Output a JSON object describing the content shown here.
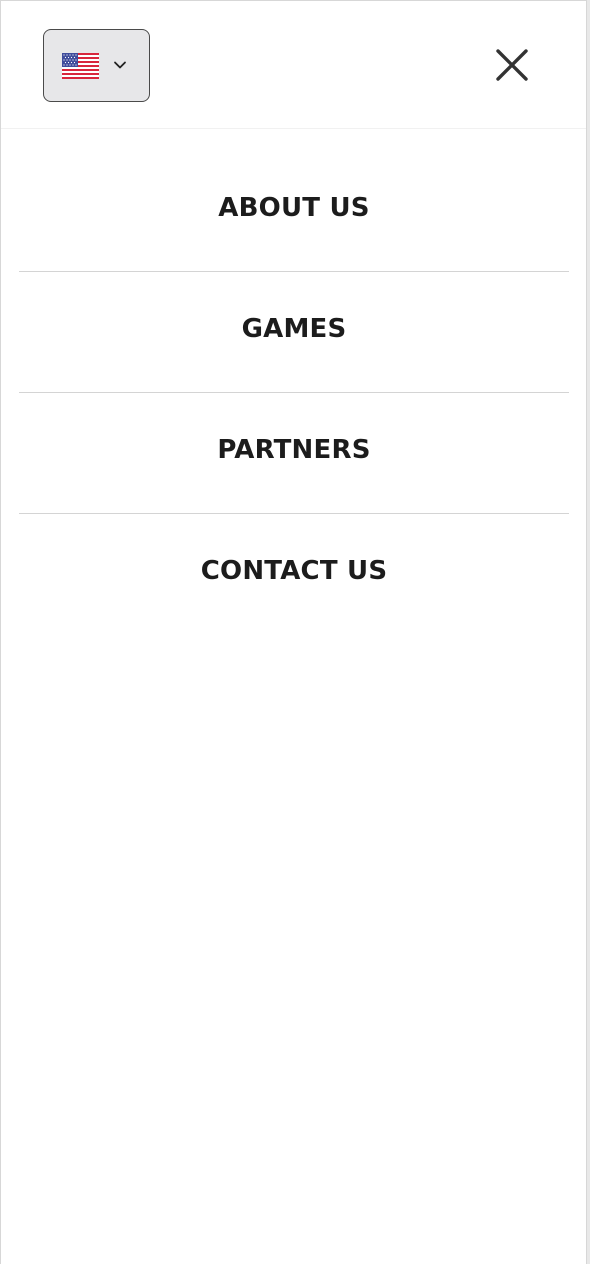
{
  "header": {
    "language": {
      "selected_icon": "us-flag-icon",
      "dropdown_icon": "chevron-down-icon"
    },
    "close_icon": "close-icon"
  },
  "menu": {
    "items": [
      {
        "label": "ABOUT US"
      },
      {
        "label": "GAMES"
      },
      {
        "label": "PARTNERS"
      },
      {
        "label": "CONTACT US"
      }
    ]
  },
  "colors": {
    "text": "#1c1c1c",
    "divider": "#d4d4d4",
    "language_button_bg": "#e7e7e9",
    "close_icon": "#333333"
  }
}
